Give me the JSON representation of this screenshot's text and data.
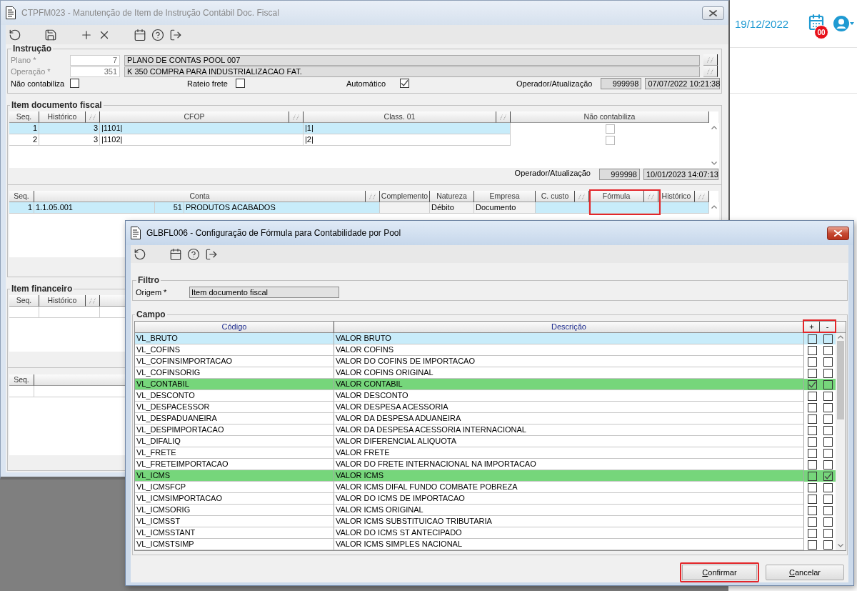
{
  "desktop": {
    "date": "19/12/2022",
    "calendar_badge": "00"
  },
  "main_window": {
    "title": "CTPFM023 - Manutenção de Item de Instrução Contábil Doc. Fiscal",
    "active": false
  },
  "instrucao": {
    "title": "Instrução",
    "fields": [
      {
        "label": "Plano *",
        "code": "7",
        "description": "PLANO DE CONTAS POOL 007",
        "disabled": true
      },
      {
        "label": "Operação *",
        "code": "351",
        "description": "K 350 COMPRA PARA INDUSTRIALIZACAO FAT.",
        "disabled": true
      }
    ],
    "options": [
      {
        "label": "Não contabiliza",
        "checked": false
      },
      {
        "label": "Rateio frete",
        "checked": false
      },
      {
        "label": "Automático",
        "checked": true
      }
    ],
    "audit": {
      "label": "Operador/Atualização",
      "operator": "999998",
      "timestamp": "07/07/2022 10:21:38"
    }
  },
  "item_documento_fiscal": {
    "title": "Item documento fiscal",
    "columns": [
      {
        "label": "Seq.",
        "lookup": false
      },
      {
        "label": "Histórico",
        "lookup": true
      },
      {
        "label": "CFOP",
        "lookup": true
      },
      {
        "label": "Class. 01",
        "lookup": true
      },
      {
        "label": "Não contabiliza",
        "lookup": false
      }
    ],
    "rows": [
      {
        "cells": [
          "1",
          "3",
          "|1101|",
          "|1|"
        ],
        "nao_contabiliza": false,
        "selected": true
      },
      {
        "cells": [
          "2",
          "3",
          "|1102|",
          "|2|"
        ],
        "nao_contabiliza": false,
        "selected": false
      }
    ],
    "audit": {
      "label": "Operador/Atualização",
      "operator": "999998",
      "timestamp": "10/01/2023 14:07:13"
    }
  },
  "accounts_table": {
    "columns": [
      {
        "label": "Seq.",
        "lookup": false,
        "readonly": false,
        "highlighted": false
      },
      {
        "label": "Conta",
        "lookup": true,
        "readonly": false,
        "highlighted": false
      },
      {
        "label": "Complemento",
        "lookup": false,
        "readonly": true,
        "highlighted": false
      },
      {
        "label": "Natureza",
        "lookup": false,
        "readonly": true,
        "highlighted": false
      },
      {
        "label": "Empresa",
        "lookup": false,
        "readonly": true,
        "highlighted": false
      },
      {
        "label": "C. custo",
        "lookup": true,
        "readonly": false,
        "highlighted": false
      },
      {
        "label": "Fórmula",
        "lookup": true,
        "readonly": false,
        "highlighted": true
      },
      {
        "label": "Histórico",
        "lookup": true,
        "readonly": false,
        "highlighted": false
      }
    ],
    "rows": [
      {
        "seq": "1",
        "conta": "1.1.05.001",
        "conta_numero": "51",
        "conta_descricao": "PRODUTOS ACABADOS",
        "natureza": "Débito",
        "empresa": "Documento",
        "selected": true
      }
    ]
  },
  "item_financeiro": {
    "title": "Item financeiro",
    "columns": [
      {
        "label": "Seq.",
        "lookup": false
      },
      {
        "label": "Histórico",
        "lookup": true
      }
    ]
  },
  "lower_table": {
    "columns": [
      {
        "label": "Seq.",
        "lookup": false
      }
    ]
  },
  "dialog": {
    "title": "GLBFL006 - Configuração de Fórmula para Contabilidade por Pool",
    "active": true,
    "filtro": {
      "title": "Filtro",
      "label": "Origem *",
      "value": "Item documento fiscal"
    },
    "campo": {
      "title": "Campo",
      "columns": [
        {
          "label": "Código"
        },
        {
          "label": "Descrição"
        }
      ],
      "toggles": {
        "plus": "+",
        "minus": "-",
        "highlighted": true
      },
      "rows": [
        {
          "codigo": "VL_BRUTO",
          "descricao": "VALOR BRUTO",
          "plus": false,
          "minus": false,
          "selected": true
        },
        {
          "codigo": "VL_COFINS",
          "descricao": "VALOR COFINS",
          "plus": false,
          "minus": false,
          "selected": false
        },
        {
          "codigo": "VL_COFINSIMPORTACAO",
          "descricao": "VALOR DO COFINS DE IMPORTACAO",
          "plus": false,
          "minus": false,
          "selected": false
        },
        {
          "codigo": "VL_COFINSORIG",
          "descricao": "VALOR COFINS ORIGINAL",
          "plus": false,
          "minus": false,
          "selected": false
        },
        {
          "codigo": "VL_CONTABIL",
          "descricao": "VALOR CONTABIL",
          "plus": true,
          "minus": false,
          "selected": false
        },
        {
          "codigo": "VL_DESCONTO",
          "descricao": "VALOR DESCONTO",
          "plus": false,
          "minus": false,
          "selected": false
        },
        {
          "codigo": "VL_DESPACESSOR",
          "descricao": "VALOR DESPESA ACESSORIA",
          "plus": false,
          "minus": false,
          "selected": false
        },
        {
          "codigo": "VL_DESPADUANEIRA",
          "descricao": "VALOR DA DESPESA ADUANEIRA",
          "plus": false,
          "minus": false,
          "selected": false
        },
        {
          "codigo": "VL_DESPIMPORTACAO",
          "descricao": "VALOR DA DESPESA ACESSORIA INTERNACIONAL",
          "plus": false,
          "minus": false,
          "selected": false
        },
        {
          "codigo": "VL_DIFALIQ",
          "descricao": "VALOR DIFERENCIAL ALIQUOTA",
          "plus": false,
          "minus": false,
          "selected": false
        },
        {
          "codigo": "VL_FRETE",
          "descricao": "VALOR FRETE",
          "plus": false,
          "minus": false,
          "selected": false
        },
        {
          "codigo": "VL_FRETEIMPORTACAO",
          "descricao": "VALOR DO FRETE INTERNACIONAL NA IMPORTACAO",
          "plus": false,
          "minus": false,
          "selected": false
        },
        {
          "codigo": "VL_ICMS",
          "descricao": "VALOR ICMS",
          "plus": false,
          "minus": true,
          "selected": false
        },
        {
          "codigo": "VL_ICMSFCP",
          "descricao": "VALOR ICMS DIFAL FUNDO COMBATE POBREZA",
          "plus": false,
          "minus": false,
          "selected": false
        },
        {
          "codigo": "VL_ICMSIMPORTACAO",
          "descricao": "VALOR DO ICMS DE IMPORTACAO",
          "plus": false,
          "minus": false,
          "selected": false
        },
        {
          "codigo": "VL_ICMSORIG",
          "descricao": "VALOR ICMS ORIGINAL",
          "plus": false,
          "minus": false,
          "selected": false
        },
        {
          "codigo": "VL_ICMSST",
          "descricao": "VALOR ICMS SUBSTITUICAO TRIBUTARIA",
          "plus": false,
          "minus": false,
          "selected": false
        },
        {
          "codigo": "VL_ICMSSTANT",
          "descricao": "VALOR DO ICMS ST ANTECIPADO",
          "plus": false,
          "minus": false,
          "selected": false
        },
        {
          "codigo": "VL_ICMSTSIMP",
          "descricao": "VALOR ICMS SIMPLES NACIONAL",
          "plus": false,
          "minus": false,
          "selected": false
        }
      ]
    },
    "buttons": [
      {
        "label": "Confirmar",
        "highlighted": true
      },
      {
        "label": "Cancelar",
        "highlighted": false
      }
    ]
  }
}
